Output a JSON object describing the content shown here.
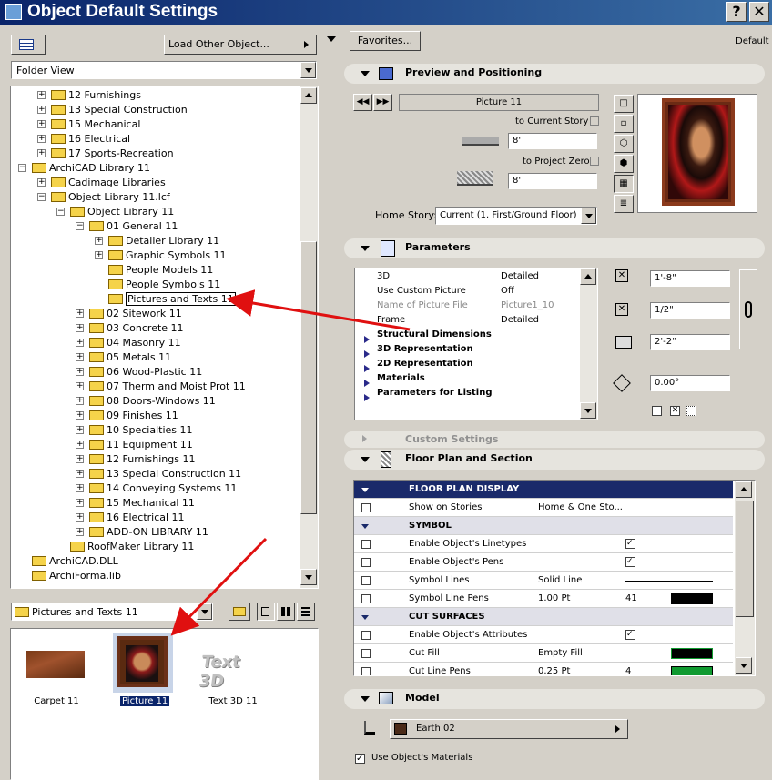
{
  "window": {
    "title": "Object Default Settings",
    "help_btn": "?",
    "close_btn": "✕"
  },
  "left": {
    "load_other": "Load Other Object...",
    "view_mode": "Folder View",
    "tree": [
      {
        "label": "12 Furnishings",
        "indent": 1,
        "pm": "+"
      },
      {
        "label": "13 Special Construction",
        "indent": 1,
        "pm": "+"
      },
      {
        "label": "15 Mechanical",
        "indent": 1,
        "pm": "+"
      },
      {
        "label": "16 Electrical",
        "indent": 1,
        "pm": "+"
      },
      {
        "label": "17 Sports-Recreation",
        "indent": 1,
        "pm": "+"
      },
      {
        "label": "ArchiCAD Library 11",
        "indent": 0,
        "pm": "-"
      },
      {
        "label": "Cadimage Libraries",
        "indent": 1,
        "pm": "+"
      },
      {
        "label": "Object Library 11.lcf",
        "indent": 1,
        "pm": "-"
      },
      {
        "label": "Object Library 11",
        "indent": 2,
        "pm": "-"
      },
      {
        "label": "01 General 11",
        "indent": 3,
        "pm": "-"
      },
      {
        "label": "Detailer Library 11",
        "indent": 4,
        "pm": "+"
      },
      {
        "label": "Graphic Symbols 11",
        "indent": 4,
        "pm": "+"
      },
      {
        "label": "People Models 11",
        "indent": 4,
        "pm": ""
      },
      {
        "label": "People Symbols 11",
        "indent": 4,
        "pm": ""
      },
      {
        "label": "Pictures and Texts 11",
        "indent": 4,
        "pm": "",
        "selected": true
      },
      {
        "label": "02 Sitework 11",
        "indent": 3,
        "pm": "+"
      },
      {
        "label": "03 Concrete 11",
        "indent": 3,
        "pm": "+"
      },
      {
        "label": "04 Masonry 11",
        "indent": 3,
        "pm": "+"
      },
      {
        "label": "05 Metals 11",
        "indent": 3,
        "pm": "+"
      },
      {
        "label": "06 Wood-Plastic 11",
        "indent": 3,
        "pm": "+"
      },
      {
        "label": "07 Therm and Moist Prot 11",
        "indent": 3,
        "pm": "+"
      },
      {
        "label": "08 Doors-Windows 11",
        "indent": 3,
        "pm": "+"
      },
      {
        "label": "09 Finishes 11",
        "indent": 3,
        "pm": "+"
      },
      {
        "label": "10 Specialties 11",
        "indent": 3,
        "pm": "+"
      },
      {
        "label": "11 Equipment 11",
        "indent": 3,
        "pm": "+"
      },
      {
        "label": "12 Furnishings 11",
        "indent": 3,
        "pm": "+"
      },
      {
        "label": "13 Special Construction 11",
        "indent": 3,
        "pm": "+"
      },
      {
        "label": "14 Conveying Systems 11",
        "indent": 3,
        "pm": "+"
      },
      {
        "label": "15 Mechanical 11",
        "indent": 3,
        "pm": "+"
      },
      {
        "label": "16 Electrical 11",
        "indent": 3,
        "pm": "+"
      },
      {
        "label": "ADD-ON LIBRARY 11",
        "indent": 3,
        "pm": "+"
      },
      {
        "label": "RoofMaker Library 11",
        "indent": 2,
        "pm": ""
      },
      {
        "label": "ArchiCAD.DLL",
        "indent": 0,
        "pm": ""
      },
      {
        "label": "ArchiForma.lib",
        "indent": 0,
        "pm": ""
      }
    ],
    "folder_select": "Pictures and Texts 11",
    "thumbs": [
      {
        "label": "Carpet 11"
      },
      {
        "label": "Picture 11",
        "selected": true
      },
      {
        "label": "Text 3D 11",
        "art": "Text 3D"
      }
    ]
  },
  "right": {
    "favorites": "Favorites...",
    "default": "Default",
    "preview": {
      "title": "Preview and Positioning",
      "name": "Picture 11",
      "to_current_story": "to Current Story",
      "current_val": "8'",
      "to_project_zero": "to Project Zero",
      "zero_val": "8'",
      "home_story_label": "Home Story:",
      "home_story": "Current (1. First/Ground Floor)"
    },
    "parameters": {
      "title": "Parameters",
      "rows": [
        {
          "name": "3D",
          "value": "Detailed"
        },
        {
          "name": "Use Custom Picture",
          "value": "Off"
        },
        {
          "name": "Name of Picture File",
          "value": "Picture1_10",
          "dim": true
        },
        {
          "name": "Frame",
          "value": "Detailed"
        }
      ],
      "groups": [
        "Structural Dimensions",
        "3D Representation",
        "2D Representation",
        "Materials",
        "Parameters for Listing"
      ],
      "width": "1'-8\"",
      "depth": "1/2\"",
      "height": "2'-2\"",
      "angle": "0.00°"
    },
    "custom_settings": "Custom Settings",
    "floorplan": {
      "title": "Floor Plan and Section",
      "rows": [
        {
          "type": "hdr",
          "name": "FLOOR PLAN DISPLAY",
          "dark": true
        },
        {
          "name": "Show on Stories",
          "value": "Home & One Sto..."
        },
        {
          "type": "hdr",
          "name": "SYMBOL"
        },
        {
          "name": "Enable Object's Linetypes",
          "check": "✓"
        },
        {
          "name": "Enable Object's Pens",
          "check": "✓"
        },
        {
          "name": "Symbol Lines",
          "value": "Solid Line"
        },
        {
          "name": "Symbol Line Pens",
          "value": "1.00 Pt",
          "num": "41"
        },
        {
          "type": "hdr",
          "name": "CUT SURFACES"
        },
        {
          "name": "Enable Object's Attributes",
          "check": "✓"
        },
        {
          "name": "Cut Fill",
          "value": "Empty Fill"
        },
        {
          "name": "Cut Line Pens",
          "value": "0.25 Pt",
          "num": "4"
        }
      ]
    },
    "model": {
      "title": "Model",
      "material": "Earth 02",
      "use_materials": "Use Object's Materials",
      "material_color": "#4a2a18"
    }
  }
}
